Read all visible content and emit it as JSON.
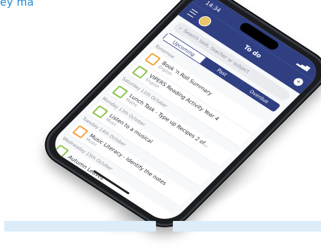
{
  "caption": "ey ma",
  "phone": {
    "time": "14:34",
    "header_title": "To do",
    "search_placeholder": "Search task, teacher or subject",
    "tabs": [
      "Upcoming",
      "Past",
      "Overdue"
    ],
    "list": [
      {
        "day": "Tomorrow",
        "title": "Book 'n Roll Summary",
        "subject": "English",
        "color": "orange"
      },
      {
        "day": "",
        "title": "VIPERS Reading Activity Year 4",
        "subject": "English",
        "color": "green"
      },
      {
        "day": "Saturday 11th October",
        "title": "Lunch Task - Type up Recipes 2 of...",
        "subject": "Maths",
        "color": "green"
      },
      {
        "day": "Monday 13th October",
        "title": "Listen to a musical",
        "subject": "Music",
        "color": "green"
      },
      {
        "day": "Tuesday 14th October",
        "title": "Music Literacy - Identify the notes",
        "subject": "Music",
        "color": "orange"
      },
      {
        "day": "Wednesday 15th October",
        "title": "Autumn Leaves",
        "subject": "",
        "color": "green"
      }
    ]
  }
}
